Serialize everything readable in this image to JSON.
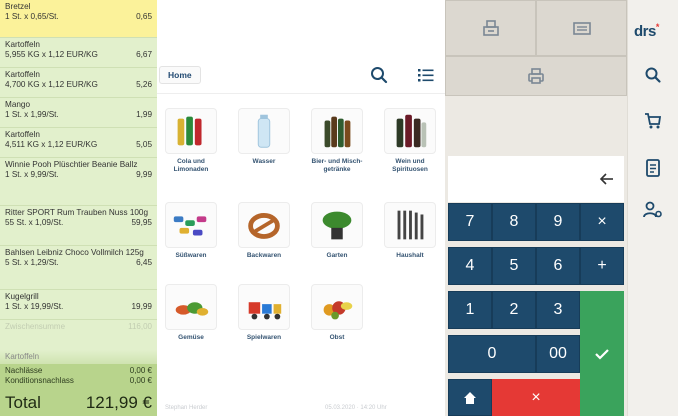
{
  "receipt": {
    "items": [
      {
        "name": "Bretzel",
        "line": "1 St. x 0,65/St.",
        "amount": "0,65",
        "highlight": true
      },
      {
        "name": "Kartoffeln",
        "line": "5,955 KG x 1,12 EUR/KG",
        "amount": "6,67"
      },
      {
        "name": "Kartoffeln",
        "line": "4,700 KG x 1,12 EUR/KG",
        "amount": "5,26"
      },
      {
        "name": "Mango",
        "line": "1 St. x 1,99/St.",
        "amount": "1,99"
      },
      {
        "name": "Kartoffeln",
        "line": "4,511 KG x 1,12 EUR/KG",
        "amount": "5,05"
      },
      {
        "name": "Winnie Pooh Plüschtier Beanie Ballz",
        "line": "1 St. x 9,99/St.",
        "amount": "9,99"
      },
      {
        "name": "Ritter SPORT Rum Trauben Nuss 100g",
        "line": "55 St. x 1,09/St.",
        "amount": "59,95"
      },
      {
        "name": "Bahlsen Leibniz Choco Vollmilch 125g",
        "line": "5 St. x 1,29/St.",
        "amount": "6,45"
      },
      {
        "name": "Kugelgrill",
        "line": "1 St. x 19,99/St.",
        "amount": "19,99"
      }
    ],
    "subtotal_label": "Zwischensumme",
    "subtotal_value": "116,00",
    "faded_item": "Kartoffeln",
    "discounts_label": "Nachlässe",
    "discounts_value": "0,00 €",
    "condition_label": "Konditionsnachlass",
    "condition_value": "0,00 €",
    "total_label": "Total",
    "total_value": "121,99 €"
  },
  "catalog": {
    "breadcrumb": "Home",
    "tiles": [
      {
        "label": "Cola und Limonaden",
        "icon": "soft-drinks-icon"
      },
      {
        "label": "Wasser",
        "icon": "water-bottle-icon"
      },
      {
        "label": "Bier- und Misch- getränke",
        "icon": "beer-bottles-icon"
      },
      {
        "label": "Wein und Spirituosen",
        "icon": "wine-bottles-icon"
      },
      {
        "label": "Süßwaren",
        "icon": "candy-icon"
      },
      {
        "label": "Backwaren",
        "icon": "pretzel-icon"
      },
      {
        "label": "Garten",
        "icon": "plant-icon"
      },
      {
        "label": "Haushalt",
        "icon": "knives-icon"
      },
      {
        "label": "Gemüse",
        "icon": "vegetables-icon"
      },
      {
        "label": "Spielwaren",
        "icon": "toy-train-icon"
      },
      {
        "label": "Obst",
        "icon": "fruit-icon"
      }
    ],
    "status_user": "Stephan Herder",
    "status_time": "05.03.2020 · 14:20 Uhr"
  },
  "register": {
    "display": "",
    "keys": [
      "7",
      "8",
      "9",
      "×",
      "4",
      "5",
      "6",
      "+",
      "1",
      "2",
      "3",
      "0",
      "00"
    ],
    "cancel_label": "×"
  },
  "nav": {
    "logo_text": "drs",
    "logo_mark": "*"
  },
  "colors": {
    "accent": "#1e4a6c",
    "receipt_bg": "#e2f0cc",
    "receipt_highlight": "#fbf29a",
    "ok_green": "#3aa35c",
    "cancel_red": "#e53935",
    "pointer_pink": "#d81b60"
  }
}
